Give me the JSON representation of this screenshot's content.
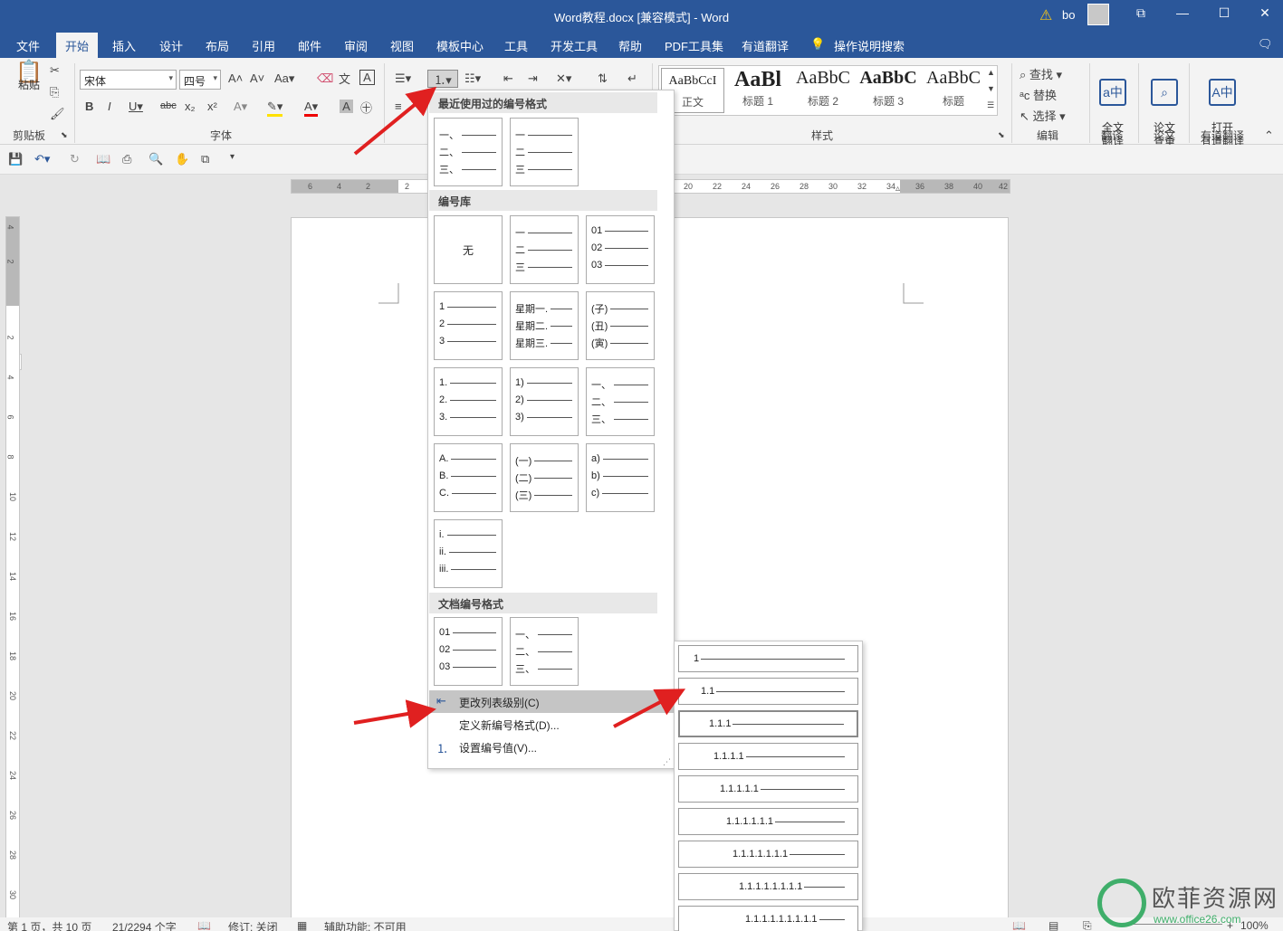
{
  "window": {
    "title": "Word教程.docx [兼容模式]  -  Word",
    "user": "bo",
    "warning_icon": "warning-icon",
    "accent": "#2b579a"
  },
  "tabs": [
    "文件",
    "开始",
    "插入",
    "设计",
    "布局",
    "引用",
    "邮件",
    "审阅",
    "视图",
    "模板中心",
    "工具",
    "开发工具",
    "帮助",
    "PDF工具集",
    "有道翻译",
    "操作说明搜索"
  ],
  "active_tab": "开始",
  "ribbon": {
    "paste": "粘贴",
    "clipboard_group": "剪贴板",
    "font_name": "宋体",
    "font_size": "四号",
    "font_group": "字体",
    "styles_group": "样式",
    "styles": [
      {
        "preview": "AaBbCcI",
        "name": "正文"
      },
      {
        "preview": "AaBl",
        "name": "标题 1"
      },
      {
        "preview": "AaBbC",
        "name": "标题 2"
      },
      {
        "preview": "AaBbC",
        "name": "标题 3"
      },
      {
        "preview": "AaBbC",
        "name": "标题"
      }
    ],
    "find": "查找",
    "replace": "替换",
    "select": "选择",
    "editing_group": "编辑",
    "full_translate": "全文\n翻译",
    "translate_group": "翻译",
    "paper_check": "论文\n查重",
    "paper_group": "论文",
    "open_youdao": "打开\n有道翻译",
    "youdao_group": "有道翻译"
  },
  "ruler": {
    "h_left": [
      "6",
      "4",
      "2",
      "2"
    ],
    "h_right": [
      "20",
      "22",
      "24",
      "26",
      "28",
      "30",
      "32",
      "34",
      "36",
      "38",
      "40",
      "42"
    ],
    "v": [
      "4",
      "2",
      "2",
      "4",
      "6",
      "8",
      "10",
      "12",
      "14",
      "16",
      "18",
      "20",
      "22",
      "24",
      "26",
      "28",
      "30"
    ]
  },
  "dropdown": {
    "recent_header": "最近使用过的编号格式",
    "library_header": "编号库",
    "document_header": "文档编号格式",
    "none_label": "无",
    "recent": [
      [
        "一、",
        "二、",
        "三、"
      ],
      [
        "一",
        "二",
        "三"
      ]
    ],
    "library": [
      [
        "一",
        "二",
        "三"
      ],
      [
        "01",
        "02",
        "03"
      ],
      [
        "1",
        "2",
        "3"
      ],
      [
        "星期一.",
        "星期二.",
        "星期三."
      ],
      [
        "(子)",
        "(丑)",
        "(寅)"
      ],
      [
        "1.",
        "2.",
        "3."
      ],
      [
        "1)",
        "2)",
        "3)"
      ],
      [
        "一、",
        "二、",
        "三、"
      ],
      [
        "A.",
        "B.",
        "C."
      ],
      [
        "(一)",
        "(二)",
        "(三)"
      ],
      [
        "a)",
        "b)",
        "c)"
      ],
      [
        "i.",
        "ii.",
        "iii."
      ]
    ],
    "document": [
      [
        "01",
        "02",
        "03"
      ],
      [
        "一、",
        "二、",
        "三、"
      ]
    ],
    "menu": {
      "change_level": "更改列表级别(C)",
      "define_new": "定义新编号格式(D)...",
      "set_value": "设置编号值(V)..."
    }
  },
  "levels": [
    "1",
    "1.1",
    "1.1.1",
    "1.1.1.1",
    "1.1.1.1.1",
    "1.1.1.1.1.1",
    "1.1.1.1.1.1.1",
    "1.1.1.1.1.1.1.1",
    "1.1.1.1.1.1.1.1.1"
  ],
  "status": {
    "page": "第 1 页，共 10 页",
    "words": "21/2294 个字",
    "track": "修订: 关闭",
    "accessibility": "辅助功能: 不可用",
    "zoom": "100%"
  },
  "watermark": {
    "name": "欧菲资源网",
    "url": "www.office26.com"
  }
}
